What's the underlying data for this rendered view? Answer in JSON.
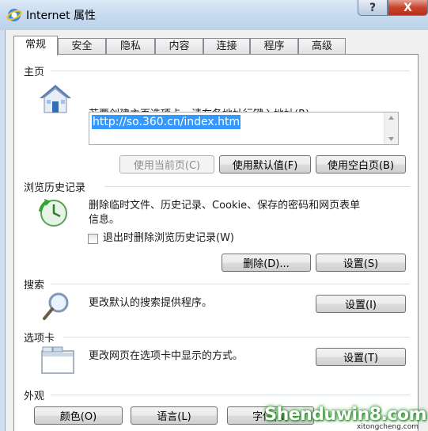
{
  "window": {
    "title": "Internet 属性",
    "help_glyph": "?",
    "close_glyph": "X"
  },
  "tabs": [
    {
      "label": "常规",
      "active": true
    },
    {
      "label": "安全"
    },
    {
      "label": "隐私"
    },
    {
      "label": "内容"
    },
    {
      "label": "连接"
    },
    {
      "label": "程序"
    },
    {
      "label": "高级"
    }
  ],
  "homepage": {
    "title": "主页",
    "description": "若要创建主页选项卡，请在各地址行键入地址(R)。",
    "url": "http://so.360.cn/index.htm",
    "use_current_label": "使用当前页(C)",
    "use_default_label": "使用默认值(F)",
    "use_blank_label": "使用空白页(B)"
  },
  "history": {
    "title": "浏览历史记录",
    "description_line1": "删除临时文件、历史记录、Cookie、保存的密码和网页表单",
    "description_line2": "信息。",
    "checkbox_label": "退出时删除浏览历史记录(W)",
    "delete_label": "删除(D)...",
    "settings_label": "设置(S)"
  },
  "search": {
    "title": "搜索",
    "description": "更改默认的搜索提供程序。",
    "settings_label": "设置(I)"
  },
  "tabs_section": {
    "title": "选项卡",
    "description": "更改网页在选项卡中显示的方式。",
    "settings_label": "设置(T)"
  },
  "appearance": {
    "title": "外观",
    "colors_label": "颜色(O)",
    "languages_label": "语言(L)",
    "fonts_label": "字体(N)"
  },
  "watermark": {
    "text": "Shenduwin8.com",
    "sub": "xitongcheng.com"
  },
  "colors": {
    "accent": "#3399ff",
    "close_button": "#c8442c"
  }
}
